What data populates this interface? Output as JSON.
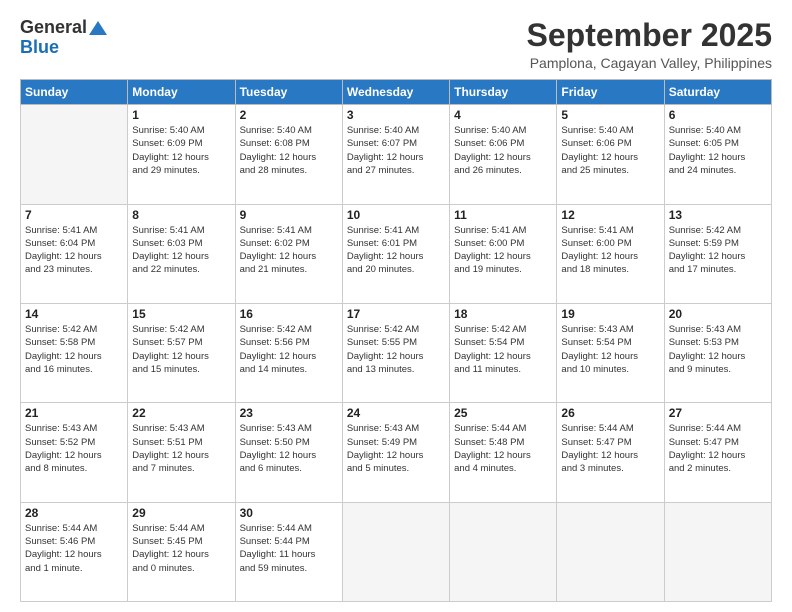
{
  "header": {
    "logo_line1": "General",
    "logo_line2": "Blue",
    "month": "September 2025",
    "location": "Pamplona, Cagayan Valley, Philippines"
  },
  "weekdays": [
    "Sunday",
    "Monday",
    "Tuesday",
    "Wednesday",
    "Thursday",
    "Friday",
    "Saturday"
  ],
  "weeks": [
    [
      {
        "day": "",
        "info": ""
      },
      {
        "day": "1",
        "info": "Sunrise: 5:40 AM\nSunset: 6:09 PM\nDaylight: 12 hours\nand 29 minutes."
      },
      {
        "day": "2",
        "info": "Sunrise: 5:40 AM\nSunset: 6:08 PM\nDaylight: 12 hours\nand 28 minutes."
      },
      {
        "day": "3",
        "info": "Sunrise: 5:40 AM\nSunset: 6:07 PM\nDaylight: 12 hours\nand 27 minutes."
      },
      {
        "day": "4",
        "info": "Sunrise: 5:40 AM\nSunset: 6:06 PM\nDaylight: 12 hours\nand 26 minutes."
      },
      {
        "day": "5",
        "info": "Sunrise: 5:40 AM\nSunset: 6:06 PM\nDaylight: 12 hours\nand 25 minutes."
      },
      {
        "day": "6",
        "info": "Sunrise: 5:40 AM\nSunset: 6:05 PM\nDaylight: 12 hours\nand 24 minutes."
      }
    ],
    [
      {
        "day": "7",
        "info": "Sunrise: 5:41 AM\nSunset: 6:04 PM\nDaylight: 12 hours\nand 23 minutes."
      },
      {
        "day": "8",
        "info": "Sunrise: 5:41 AM\nSunset: 6:03 PM\nDaylight: 12 hours\nand 22 minutes."
      },
      {
        "day": "9",
        "info": "Sunrise: 5:41 AM\nSunset: 6:02 PM\nDaylight: 12 hours\nand 21 minutes."
      },
      {
        "day": "10",
        "info": "Sunrise: 5:41 AM\nSunset: 6:01 PM\nDaylight: 12 hours\nand 20 minutes."
      },
      {
        "day": "11",
        "info": "Sunrise: 5:41 AM\nSunset: 6:00 PM\nDaylight: 12 hours\nand 19 minutes."
      },
      {
        "day": "12",
        "info": "Sunrise: 5:41 AM\nSunset: 6:00 PM\nDaylight: 12 hours\nand 18 minutes."
      },
      {
        "day": "13",
        "info": "Sunrise: 5:42 AM\nSunset: 5:59 PM\nDaylight: 12 hours\nand 17 minutes."
      }
    ],
    [
      {
        "day": "14",
        "info": "Sunrise: 5:42 AM\nSunset: 5:58 PM\nDaylight: 12 hours\nand 16 minutes."
      },
      {
        "day": "15",
        "info": "Sunrise: 5:42 AM\nSunset: 5:57 PM\nDaylight: 12 hours\nand 15 minutes."
      },
      {
        "day": "16",
        "info": "Sunrise: 5:42 AM\nSunset: 5:56 PM\nDaylight: 12 hours\nand 14 minutes."
      },
      {
        "day": "17",
        "info": "Sunrise: 5:42 AM\nSunset: 5:55 PM\nDaylight: 12 hours\nand 13 minutes."
      },
      {
        "day": "18",
        "info": "Sunrise: 5:42 AM\nSunset: 5:54 PM\nDaylight: 12 hours\nand 11 minutes."
      },
      {
        "day": "19",
        "info": "Sunrise: 5:43 AM\nSunset: 5:54 PM\nDaylight: 12 hours\nand 10 minutes."
      },
      {
        "day": "20",
        "info": "Sunrise: 5:43 AM\nSunset: 5:53 PM\nDaylight: 12 hours\nand 9 minutes."
      }
    ],
    [
      {
        "day": "21",
        "info": "Sunrise: 5:43 AM\nSunset: 5:52 PM\nDaylight: 12 hours\nand 8 minutes."
      },
      {
        "day": "22",
        "info": "Sunrise: 5:43 AM\nSunset: 5:51 PM\nDaylight: 12 hours\nand 7 minutes."
      },
      {
        "day": "23",
        "info": "Sunrise: 5:43 AM\nSunset: 5:50 PM\nDaylight: 12 hours\nand 6 minutes."
      },
      {
        "day": "24",
        "info": "Sunrise: 5:43 AM\nSunset: 5:49 PM\nDaylight: 12 hours\nand 5 minutes."
      },
      {
        "day": "25",
        "info": "Sunrise: 5:44 AM\nSunset: 5:48 PM\nDaylight: 12 hours\nand 4 minutes."
      },
      {
        "day": "26",
        "info": "Sunrise: 5:44 AM\nSunset: 5:47 PM\nDaylight: 12 hours\nand 3 minutes."
      },
      {
        "day": "27",
        "info": "Sunrise: 5:44 AM\nSunset: 5:47 PM\nDaylight: 12 hours\nand 2 minutes."
      }
    ],
    [
      {
        "day": "28",
        "info": "Sunrise: 5:44 AM\nSunset: 5:46 PM\nDaylight: 12 hours\nand 1 minute."
      },
      {
        "day": "29",
        "info": "Sunrise: 5:44 AM\nSunset: 5:45 PM\nDaylight: 12 hours\nand 0 minutes."
      },
      {
        "day": "30",
        "info": "Sunrise: 5:44 AM\nSunset: 5:44 PM\nDaylight: 11 hours\nand 59 minutes."
      },
      {
        "day": "",
        "info": ""
      },
      {
        "day": "",
        "info": ""
      },
      {
        "day": "",
        "info": ""
      },
      {
        "day": "",
        "info": ""
      }
    ]
  ]
}
